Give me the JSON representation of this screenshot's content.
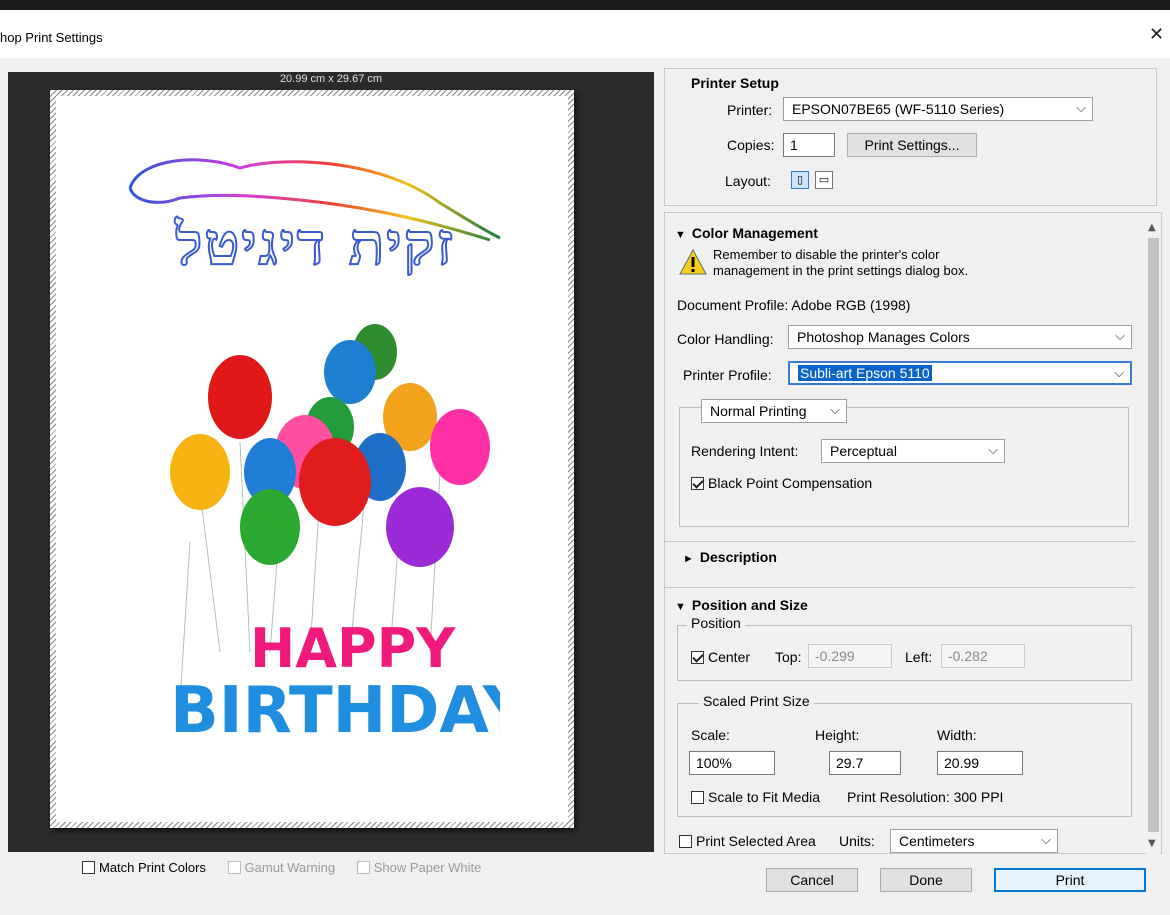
{
  "window": {
    "title": "hop Print Settings",
    "close_glyph": "✕"
  },
  "preview": {
    "paper_size": "20.99 cm x 29.67 cm",
    "checkboxes": {
      "match_print_colors": "Match Print Colors",
      "gamut_warning": "Gamut Warning",
      "show_paper_white": "Show Paper White"
    }
  },
  "printer_setup": {
    "header": "Printer Setup",
    "printer_label": "Printer:",
    "printer_value": "EPSON07BE65 (WF-5110 Series)",
    "copies_label": "Copies:",
    "copies_value": "1",
    "print_settings_button": "Print Settings...",
    "layout_label": "Layout:"
  },
  "color_management": {
    "header": "Color Management",
    "warning_text_1": "Remember to disable the printer's color",
    "warning_text_2": "management in the print settings dialog box.",
    "document_profile": "Document Profile: Adobe RGB (1998)",
    "color_handling_label": "Color Handling:",
    "color_handling_value": "Photoshop Manages Colors",
    "printer_profile_label": "Printer Profile:",
    "printer_profile_value": "Subli-art Epson 5110",
    "normal_printing": "Normal Printing",
    "rendering_intent_label": "Rendering Intent:",
    "rendering_intent_value": "Perceptual",
    "black_point_compensation": "Black Point Compensation",
    "description_header": "Description"
  },
  "position_size": {
    "header": "Position and Size",
    "position_group": "Position",
    "center_label": "Center",
    "top_label": "Top:",
    "top_value": "-0.299",
    "left_label": "Left:",
    "left_value": "-0.282",
    "scaled_group": "Scaled Print Size",
    "scale_label": "Scale:",
    "height_label": "Height:",
    "width_label": "Width:",
    "scale_value": "100%",
    "height_value": "29.7",
    "width_value": "20.99",
    "scale_to_fit": "Scale to Fit Media",
    "print_resolution": "Print Resolution: 300 PPI",
    "print_selected_area": "Print Selected Area",
    "units_label": "Units:",
    "units_value": "Centimeters"
  },
  "buttons": {
    "cancel": "Cancel",
    "done": "Done",
    "print": "Print"
  },
  "artwork": {
    "hebrew_title": "זקית דיגיטל",
    "happy": "HAPPY",
    "birthday": "BIRTHDAY"
  }
}
